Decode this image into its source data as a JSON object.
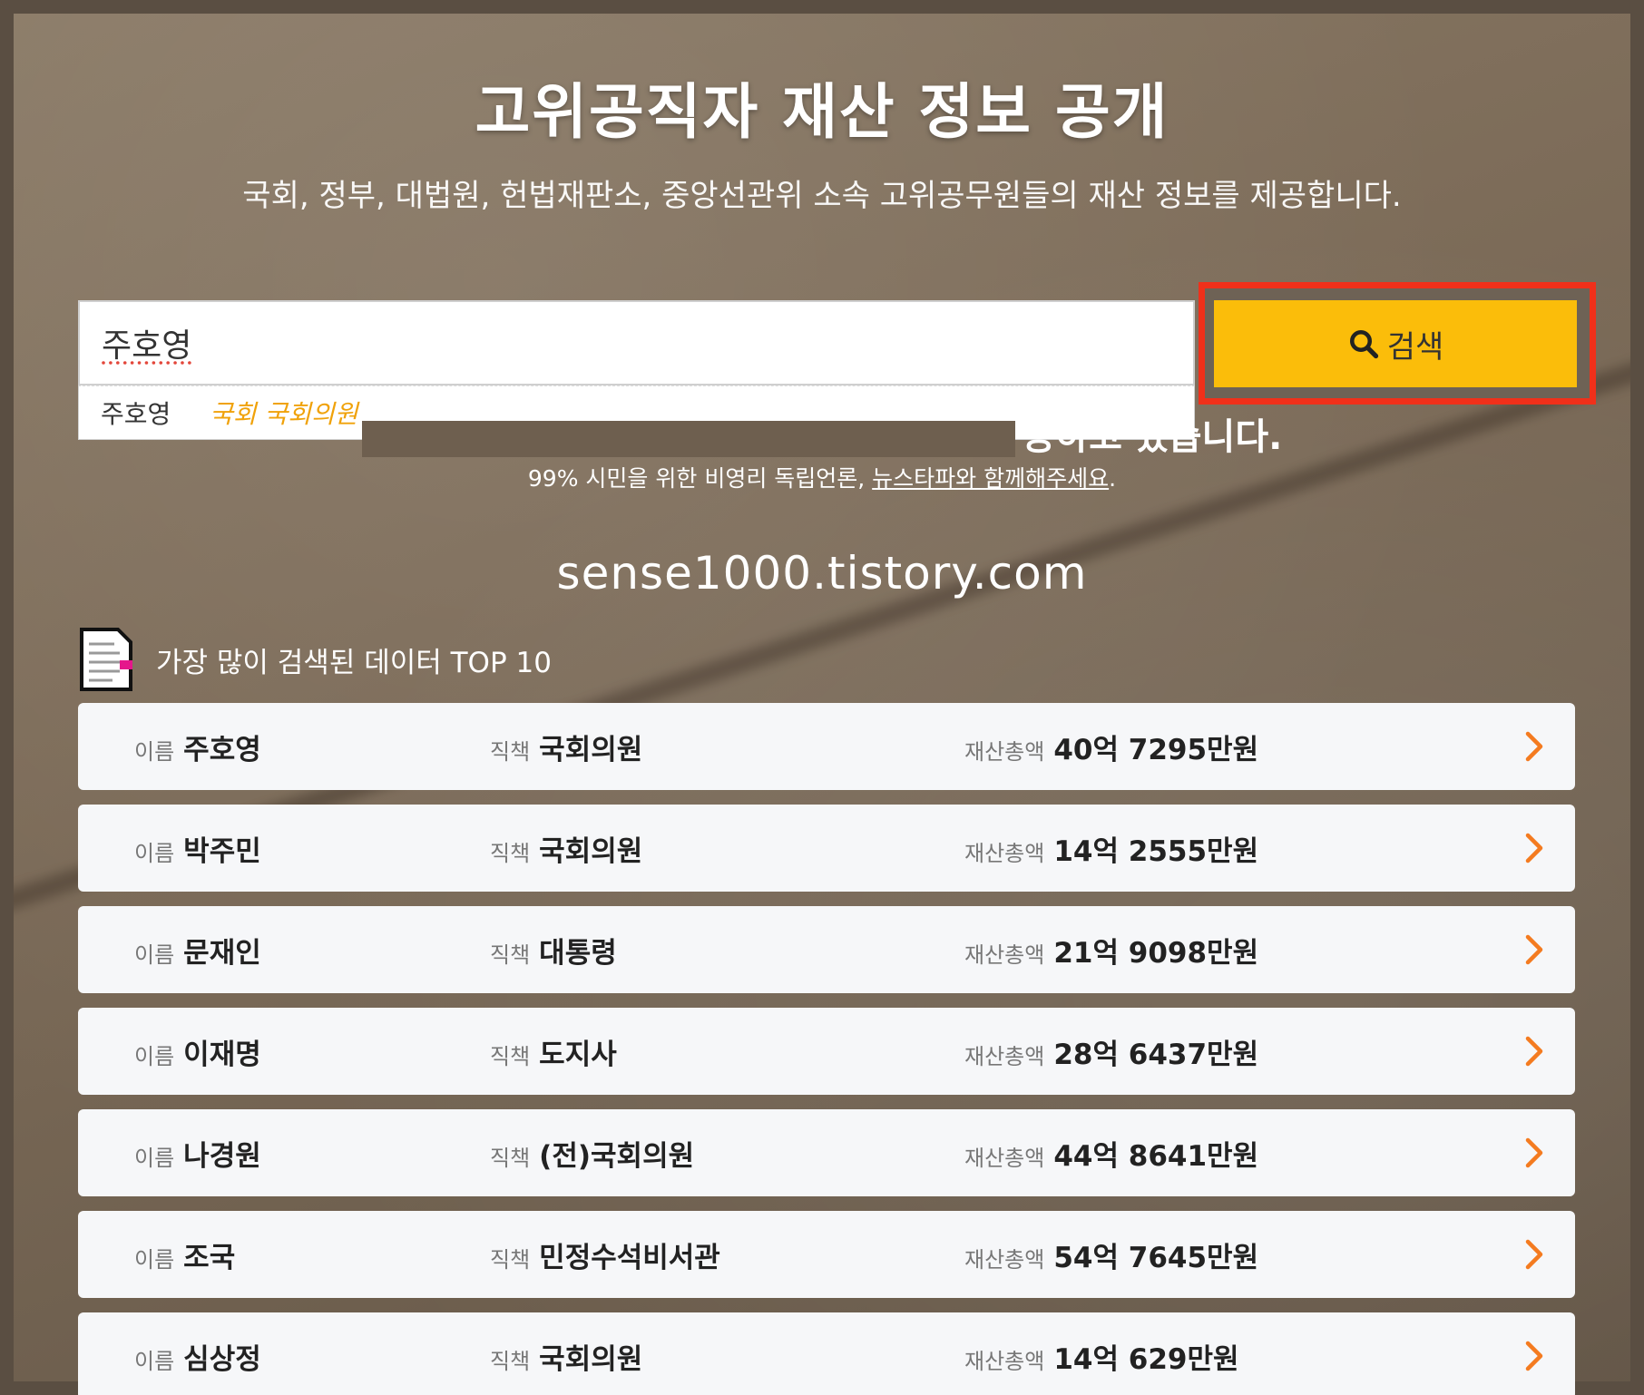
{
  "header": {
    "title": "고위공직자 재산 정보 공개",
    "subtitle": "국회, 정부, 대법원, 헌법재판소, 중앙선관위 소속 고위공무원들의 재산 정보를 제공합니다."
  },
  "search": {
    "value": "주호영",
    "button_label": "검색",
    "suggestion": {
      "name": "주호영",
      "role": "국회 국회의원"
    }
  },
  "promo": {
    "line1_visible": "공하고 있습니다.",
    "line2_prefix": "99% 시민을 위한 비영리 독립언론,",
    "line2_link": "뉴스타파와 함께해주세요",
    "line2_suffix": "."
  },
  "watermark": "sense1000.tistory.com",
  "top10": {
    "heading": "가장 많이 검색된 데이터 TOP 10",
    "labels": {
      "name": "이름",
      "role": "직책",
      "amount": "재산총액"
    },
    "rows": [
      {
        "name": "주호영",
        "role": "국회의원",
        "amount": "40억 7295만원"
      },
      {
        "name": "박주민",
        "role": "국회의원",
        "amount": "14억 2555만원"
      },
      {
        "name": "문재인",
        "role": "대통령",
        "amount": "21억 9098만원"
      },
      {
        "name": "이재명",
        "role": "도지사",
        "amount": "28억 6437만원"
      },
      {
        "name": "나경원",
        "role": "(전)국회의원",
        "amount": "44억 8641만원"
      },
      {
        "name": "조국",
        "role": "민정수석비서관",
        "amount": "54억 7645만원"
      },
      {
        "name": "심상정",
        "role": "국회의원",
        "amount": "14억 629만원"
      }
    ]
  },
  "colors": {
    "accent": "#fbbd0a",
    "highlight": "#f0301a",
    "chevron": "#f47b20",
    "suggest_role": "#f0a20a"
  }
}
